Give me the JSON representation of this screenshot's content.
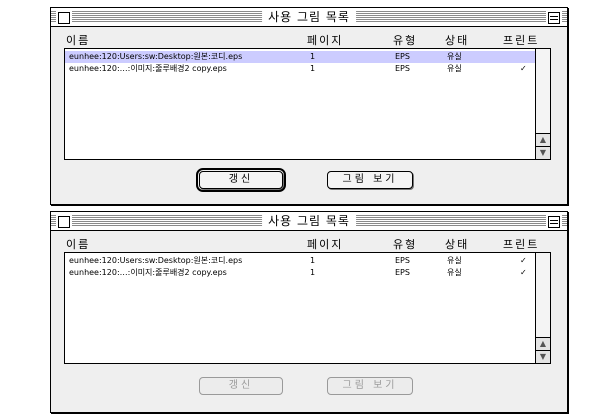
{
  "windows": [
    {
      "title": "사용 그림 목록",
      "columns": {
        "name": "이름",
        "page": "페이지",
        "type": "유형",
        "status": "상태",
        "print": "프린트"
      },
      "rows": [
        {
          "name": "eunhee:120:Users:sw:Desktop:원본:코디.eps",
          "page": "1",
          "type": "EPS",
          "status": "유실",
          "print": ""
        },
        {
          "name": "eunhee:120:…:이미지:줄루배경2 copy.eps",
          "page": "1",
          "type": "EPS",
          "status": "유실",
          "print": "✓"
        }
      ],
      "buttons": {
        "refresh": "갱신",
        "view": "그림 보기"
      }
    },
    {
      "title": "사용 그림 목록",
      "columns": {
        "name": "이름",
        "page": "페이지",
        "type": "유형",
        "status": "상태",
        "print": "프린트"
      },
      "rows": [
        {
          "name": "eunhee:120:Users:sw:Desktop:원본:코디.eps",
          "page": "1",
          "type": "EPS",
          "status": "유실",
          "print": "✓"
        },
        {
          "name": "eunhee:120:…:이미지:줄루배경2 copy.eps",
          "page": "1",
          "type": "EPS",
          "status": "유실",
          "print": "✓"
        }
      ],
      "buttons": {
        "refresh": "갱신",
        "view": "그림 보기"
      }
    }
  ]
}
